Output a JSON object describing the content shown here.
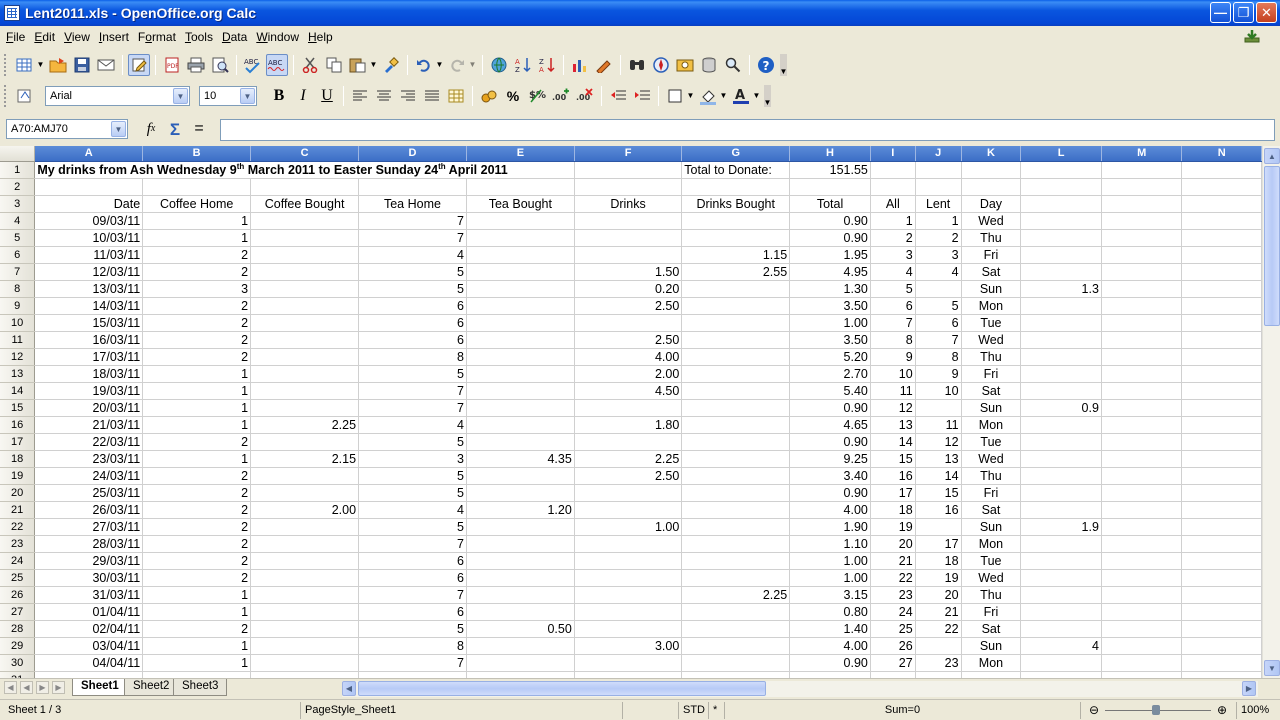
{
  "window": {
    "title": "Lent2011.xls - OpenOffice.org Calc"
  },
  "menu": [
    "File",
    "Edit",
    "View",
    "Insert",
    "Format",
    "Tools",
    "Data",
    "Window",
    "Help"
  ],
  "menu_underline": [
    "F",
    "E",
    "V",
    "I",
    "o",
    "T",
    "D",
    "W",
    "H"
  ],
  "formatting": {
    "font_name": "Arial",
    "font_size": "10"
  },
  "name_box": "A70:AMJ70",
  "formula": "",
  "columns": [
    "A",
    "B",
    "C",
    "D",
    "E",
    "F",
    "G",
    "H",
    "I",
    "J",
    "K",
    "L",
    "M",
    "N"
  ],
  "header_row": [
    "Date",
    "Coffee Home",
    "Coffee Bought",
    "Tea Home",
    "Tea Bought",
    "Drinks",
    "Drinks Bought",
    "Total",
    "All",
    "Lent",
    "Day"
  ],
  "title_row": {
    "text_a": "My drinks from Ash Wednesday 9",
    "sup1": "th",
    "text_b": " March 2011 to Easter Sunday 24",
    "sup2": "th",
    "text_c": " April 2011",
    "total_label": "Total to Donate:",
    "total_value": "151.55"
  },
  "rows": [
    [
      "09/03/11",
      "1",
      "",
      "7",
      "",
      "",
      "",
      "0.90",
      "1",
      "1",
      "Wed",
      ""
    ],
    [
      "10/03/11",
      "1",
      "",
      "7",
      "",
      "",
      "",
      "0.90",
      "2",
      "2",
      "Thu",
      ""
    ],
    [
      "11/03/11",
      "2",
      "",
      "4",
      "",
      "",
      "1.15",
      "1.95",
      "3",
      "3",
      "Fri",
      ""
    ],
    [
      "12/03/11",
      "2",
      "",
      "5",
      "",
      "1.50",
      "2.55",
      "4.95",
      "4",
      "4",
      "Sat",
      ""
    ],
    [
      "13/03/11",
      "3",
      "",
      "5",
      "",
      "0.20",
      "",
      "1.30",
      "5",
      "",
      "Sun",
      "1.3"
    ],
    [
      "14/03/11",
      "2",
      "",
      "6",
      "",
      "2.50",
      "",
      "3.50",
      "6",
      "5",
      "Mon",
      ""
    ],
    [
      "15/03/11",
      "2",
      "",
      "6",
      "",
      "",
      "",
      "1.00",
      "7",
      "6",
      "Tue",
      ""
    ],
    [
      "16/03/11",
      "2",
      "",
      "6",
      "",
      "2.50",
      "",
      "3.50",
      "8",
      "7",
      "Wed",
      ""
    ],
    [
      "17/03/11",
      "2",
      "",
      "8",
      "",
      "4.00",
      "",
      "5.20",
      "9",
      "8",
      "Thu",
      ""
    ],
    [
      "18/03/11",
      "1",
      "",
      "5",
      "",
      "2.00",
      "",
      "2.70",
      "10",
      "9",
      "Fri",
      ""
    ],
    [
      "19/03/11",
      "1",
      "",
      "7",
      "",
      "4.50",
      "",
      "5.40",
      "11",
      "10",
      "Sat",
      ""
    ],
    [
      "20/03/11",
      "1",
      "",
      "7",
      "",
      "",
      "",
      "0.90",
      "12",
      "",
      "Sun",
      "0.9"
    ],
    [
      "21/03/11",
      "1",
      "2.25",
      "4",
      "",
      "1.80",
      "",
      "4.65",
      "13",
      "11",
      "Mon",
      ""
    ],
    [
      "22/03/11",
      "2",
      "",
      "5",
      "",
      "",
      "",
      "0.90",
      "14",
      "12",
      "Tue",
      ""
    ],
    [
      "23/03/11",
      "1",
      "2.15",
      "3",
      "4.35",
      "2.25",
      "",
      "9.25",
      "15",
      "13",
      "Wed",
      ""
    ],
    [
      "24/03/11",
      "2",
      "",
      "5",
      "",
      "2.50",
      "",
      "3.40",
      "16",
      "14",
      "Thu",
      ""
    ],
    [
      "25/03/11",
      "2",
      "",
      "5",
      "",
      "",
      "",
      "0.90",
      "17",
      "15",
      "Fri",
      ""
    ],
    [
      "26/03/11",
      "2",
      "2.00",
      "4",
      "1.20",
      "",
      "",
      "4.00",
      "18",
      "16",
      "Sat",
      ""
    ],
    [
      "27/03/11",
      "2",
      "",
      "5",
      "",
      "1.00",
      "",
      "1.90",
      "19",
      "",
      "Sun",
      "1.9"
    ],
    [
      "28/03/11",
      "2",
      "",
      "7",
      "",
      "",
      "",
      "1.10",
      "20",
      "17",
      "Mon",
      ""
    ],
    [
      "29/03/11",
      "2",
      "",
      "6",
      "",
      "",
      "",
      "1.00",
      "21",
      "18",
      "Tue",
      ""
    ],
    [
      "30/03/11",
      "2",
      "",
      "6",
      "",
      "",
      "",
      "1.00",
      "22",
      "19",
      "Wed",
      ""
    ],
    [
      "31/03/11",
      "1",
      "",
      "7",
      "",
      "",
      "2.25",
      "3.15",
      "23",
      "20",
      "Thu",
      ""
    ],
    [
      "01/04/11",
      "1",
      "",
      "6",
      "",
      "",
      "",
      "0.80",
      "24",
      "21",
      "Fri",
      ""
    ],
    [
      "02/04/11",
      "2",
      "",
      "5",
      "0.50",
      "",
      "",
      "1.40",
      "25",
      "22",
      "Sat",
      ""
    ],
    [
      "03/04/11",
      "1",
      "",
      "8",
      "",
      "3.00",
      "",
      "4.00",
      "26",
      "",
      "Sun",
      "4"
    ],
    [
      "04/04/11",
      "1",
      "",
      "7",
      "",
      "",
      "",
      "0.90",
      "27",
      "23",
      "Mon",
      ""
    ]
  ],
  "sheet_tabs": [
    "Sheet1",
    "Sheet2",
    "Sheet3"
  ],
  "status": {
    "sheet": "Sheet 1 / 3",
    "page_style": "PageStyle_Sheet1",
    "mode": "STD",
    "modified": "*",
    "sum": "Sum=0",
    "zoom": "100%"
  },
  "icons": [
    "new-doc-icon",
    "open-icon",
    "save-icon",
    "email-icon",
    "edit-file-icon",
    "pdf-icon",
    "print-icon",
    "print-preview-icon",
    "spellcheck-icon",
    "autospell-icon",
    "cut-icon",
    "copy-icon",
    "paste-icon",
    "format-paintbrush-icon",
    "undo-icon",
    "redo-icon",
    "hyperlink-icon",
    "sort-asc-icon",
    "sort-desc-icon",
    "chart-icon",
    "draw-icon",
    "find-icon",
    "navigator-icon",
    "gallery-icon",
    "datasource-icon",
    "zoom-icon",
    "help-icon"
  ],
  "colors": {
    "titlebar": "#0a56df",
    "header_selected": "#3c6ec6"
  }
}
